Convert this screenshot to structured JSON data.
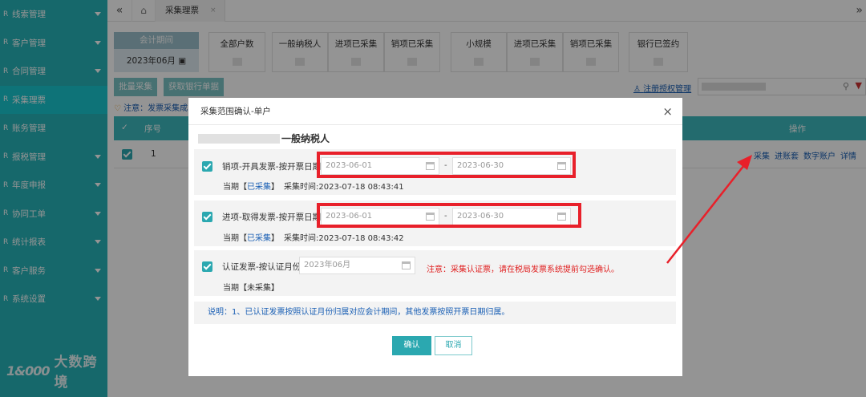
{
  "sidebar": {
    "items": [
      {
        "label": "线索管理",
        "caret": true
      },
      {
        "label": "客户管理",
        "caret": true
      },
      {
        "label": "合同管理",
        "caret": true
      },
      {
        "label": "采集理票",
        "caret": false,
        "active": true
      },
      {
        "label": "账务管理",
        "caret": false
      },
      {
        "label": "报税管理",
        "caret": true
      },
      {
        "label": "年度申报",
        "caret": true
      },
      {
        "label": "协同工单",
        "caret": true
      },
      {
        "label": "统计报表",
        "caret": true
      },
      {
        "label": "客户服务",
        "caret": true
      },
      {
        "label": "系统设置",
        "caret": true
      }
    ],
    "brand_logo": "1&000",
    "brand_name": "大数跨境"
  },
  "tabbar": {
    "collapse_icon": "«",
    "home_icon": "⌂",
    "active_tab": "采集理票",
    "close_icon": "×",
    "forward_icon": "»"
  },
  "stats": {
    "period_label": "会计期间",
    "period_value": "2023年06月",
    "items": [
      "全部户数",
      "一般纳税人",
      "进项已采集",
      "销项已采集",
      "小规模",
      "进项已采集",
      "销项已采集",
      "银行已签约"
    ]
  },
  "toolbar": {
    "batch_collect": "批量采集",
    "fetch_bank": "获取银行单据",
    "auth_manage": "注册授权管理"
  },
  "notice": {
    "prefix": "注意：发票采集成"
  },
  "grid": {
    "headers": {
      "seq": "序号",
      "op": "操作"
    },
    "row": {
      "seq": "1",
      "ops": [
        "采集",
        "进账套",
        "数字账户",
        "详情"
      ]
    }
  },
  "modal": {
    "title": "采集范围确认-单户",
    "close_icon": "×",
    "company_suffix": "一般纳税人",
    "sections": [
      {
        "label": "销项-开具发票-按开票日期:",
        "start_date": "2023-06-01",
        "end_date": "2023-06-30",
        "status_prefix": "当期【",
        "status": "已采集",
        "status_suffix": "】",
        "time_label": "采集时间:",
        "time": "2023-07-18 08:43:41"
      },
      {
        "label": "进项-取得发票-按开票日期:",
        "start_date": "2023-06-01",
        "end_date": "2023-06-30",
        "status_prefix": "当期【",
        "status": "已采集",
        "status_suffix": "】",
        "time_label": "采集时间:",
        "time": "2023-07-18 08:43:42"
      },
      {
        "label": "认证发票-按认证月份:",
        "month": "2023年06月",
        "warning": "注意：采集认证票，请在税局发票系统提前勾选确认。",
        "status_text": "当期【未采集】"
      }
    ],
    "separator": "-",
    "note": "说明：1、已认证发票按照认证月份归属对应会计期间，其他发票按照开票日期归属。",
    "confirm_label": "确认",
    "cancel_label": "取消"
  },
  "colors": {
    "sidebar_bg": "#26b3b8",
    "accent": "#2ba8b0",
    "highlight": "#e8202a",
    "link": "#1a5fb4"
  }
}
